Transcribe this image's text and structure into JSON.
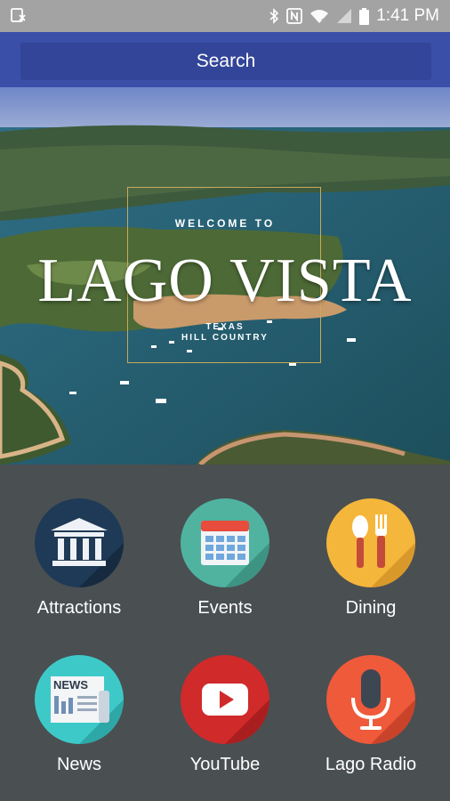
{
  "status_bar": {
    "time": "1:41 PM",
    "icons": [
      "app-notification-icon",
      "bluetooth-icon",
      "nfc-icon",
      "wifi-icon",
      "cell-signal-icon",
      "battery-icon"
    ]
  },
  "search": {
    "label": "Search"
  },
  "hero": {
    "welcome": "WELCOME TO",
    "title": "LAGO VISTA",
    "subtitle_line1": "TEXAS",
    "subtitle_line2": "HILL COUNTRY"
  },
  "menu": {
    "items": [
      {
        "label": "Attractions",
        "icon": "museum-building-icon",
        "color": "#1f3a56"
      },
      {
        "label": "Events",
        "icon": "calendar-icon",
        "color": "#4fb3a0"
      },
      {
        "label": "Dining",
        "icon": "fork-spoon-icon",
        "color": "#f4b63b"
      },
      {
        "label": "News",
        "icon": "newspaper-icon",
        "color": "#3ec9c9"
      },
      {
        "label": "YouTube",
        "icon": "youtube-play-icon",
        "color": "#d02a2a"
      },
      {
        "label": "Lago Radio",
        "icon": "microphone-icon",
        "color": "#ef5a3a"
      }
    ]
  }
}
